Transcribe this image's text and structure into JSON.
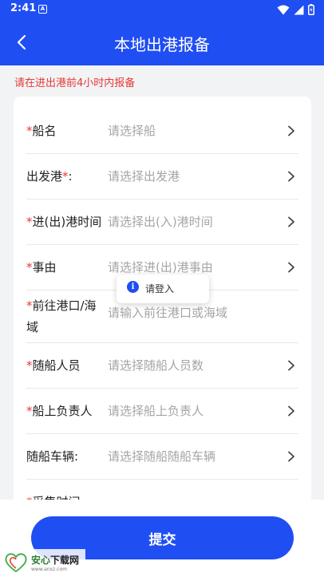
{
  "status_bar": {
    "time": "2:41",
    "badge": "A"
  },
  "header": {
    "title": "本地出港报备"
  },
  "notice": "请在进出港前4小时内报备",
  "form": {
    "rows": [
      {
        "label": "船名",
        "required_prefix": "*",
        "placeholder": "请选择船"
      },
      {
        "label": "出发港",
        "required_suffix": "*",
        "colon": ":",
        "placeholder": "请选择出发港"
      },
      {
        "label": "进(出)港时间",
        "required_prefix": "*",
        "placeholder": "请选择出(入)港时间"
      },
      {
        "label": "事由",
        "required_prefix": "*",
        "placeholder": "请选择进(出)港事由"
      },
      {
        "label_line1": "前往港口/海",
        "label_line2": "域",
        "required_prefix": "*",
        "placeholder": "请输入前往港口或海域"
      },
      {
        "label": "随船人员",
        "required_prefix": "*",
        "placeholder": "请选择随船人员数"
      },
      {
        "label": "船上负责人",
        "required_prefix": "*",
        "placeholder": "请选择船上负责人"
      },
      {
        "label": "随船车辆:",
        "placeholder": "请选择随船随船车辆"
      },
      {
        "label": "采集时间",
        "required_prefix": "*"
      }
    ]
  },
  "toast": {
    "text": "请登入",
    "icon": "info-icon"
  },
  "submit": {
    "label": "提交"
  },
  "watermark": {
    "name_green": "安心",
    "name_dark": "下载网",
    "url": "www.anxz.com"
  },
  "colors": {
    "primary": "#1f4ef3",
    "required": "#e53935",
    "placeholder": "#a5a5a5"
  }
}
